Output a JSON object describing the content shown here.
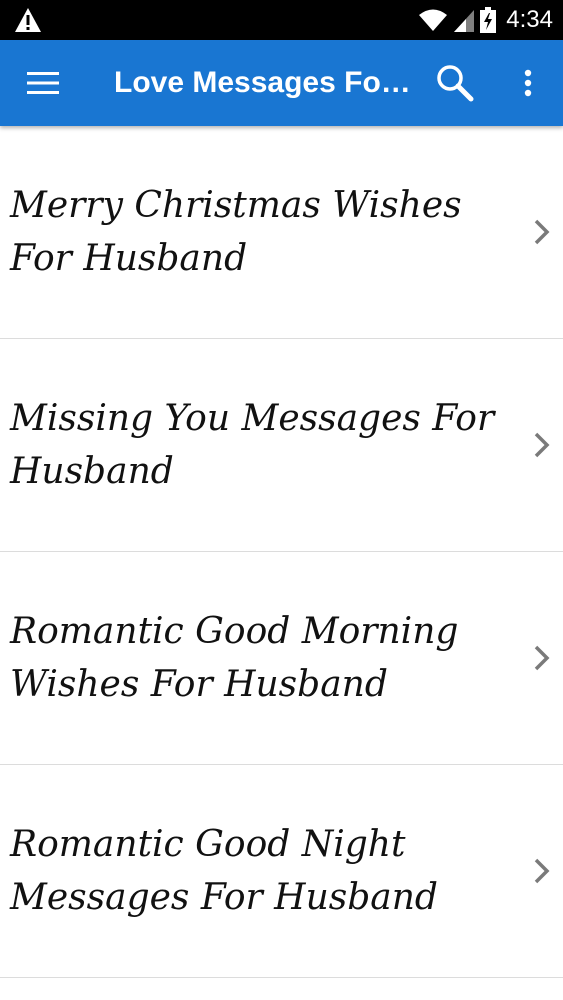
{
  "status_bar": {
    "time": "4:34",
    "icons": [
      "warning-icon",
      "wifi-icon",
      "signal-icon",
      "battery-icon"
    ]
  },
  "app_bar": {
    "title": "Love Messages For Husband",
    "icons": [
      "menu-icon",
      "search-icon",
      "more-vert-icon"
    ],
    "color": "#1976d2"
  },
  "list": {
    "items": [
      {
        "label": "Merry Christmas Wishes For Husband"
      },
      {
        "label": "Missing You Messages For Husband"
      },
      {
        "label": "Romantic Good Morning Wishes For Husband"
      },
      {
        "label": "Romantic Good Night Messages For Husband"
      }
    ]
  }
}
